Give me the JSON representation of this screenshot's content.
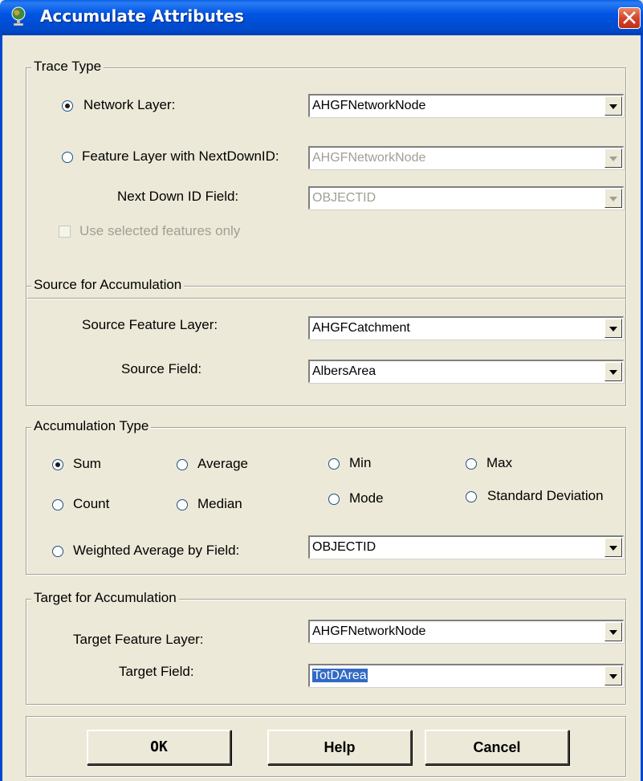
{
  "window": {
    "title": "Accumulate Attributes",
    "title_color": "#0054e3",
    "close_color": "#d4442a"
  },
  "trace_type": {
    "legend": "Trace Type",
    "network_layer_label": "Network Layer:",
    "network_layer_selected": true,
    "network_layer_value": "AHGFNetworkNode",
    "feature_layer_label": "Feature Layer with NextDownID:",
    "feature_layer_value": "AHGFNetworkNode",
    "next_down_label": "Next Down ID Field:",
    "next_down_value": "OBJECTID",
    "use_selected_label": "Use selected features only",
    "use_selected_checked": false
  },
  "source": {
    "legend": "Source for Accumulation",
    "feature_layer_label": "Source Feature Layer:",
    "feature_layer_value": "AHGFCatchment",
    "field_label": "Source Field:",
    "field_value": "AlbersArea"
  },
  "accumulation": {
    "legend": "Accumulation Type",
    "options": {
      "sum": "Sum",
      "average": "Average",
      "min": "Min",
      "max": "Max",
      "count": "Count",
      "median": "Median",
      "mode": "Mode",
      "std": "Standard Deviation",
      "weighted": "Weighted Average by Field:"
    },
    "selected": "Sum",
    "weighted_field_value": "OBJECTID"
  },
  "target": {
    "legend": "Target for Accumulation",
    "feature_layer_label": "Target Feature Layer:",
    "feature_layer_value": "AHGFNetworkNode",
    "field_label": "Target Field:",
    "field_value": "TotDArea"
  },
  "buttons": {
    "ok": "OK",
    "help": "Help",
    "cancel": "Cancel"
  }
}
